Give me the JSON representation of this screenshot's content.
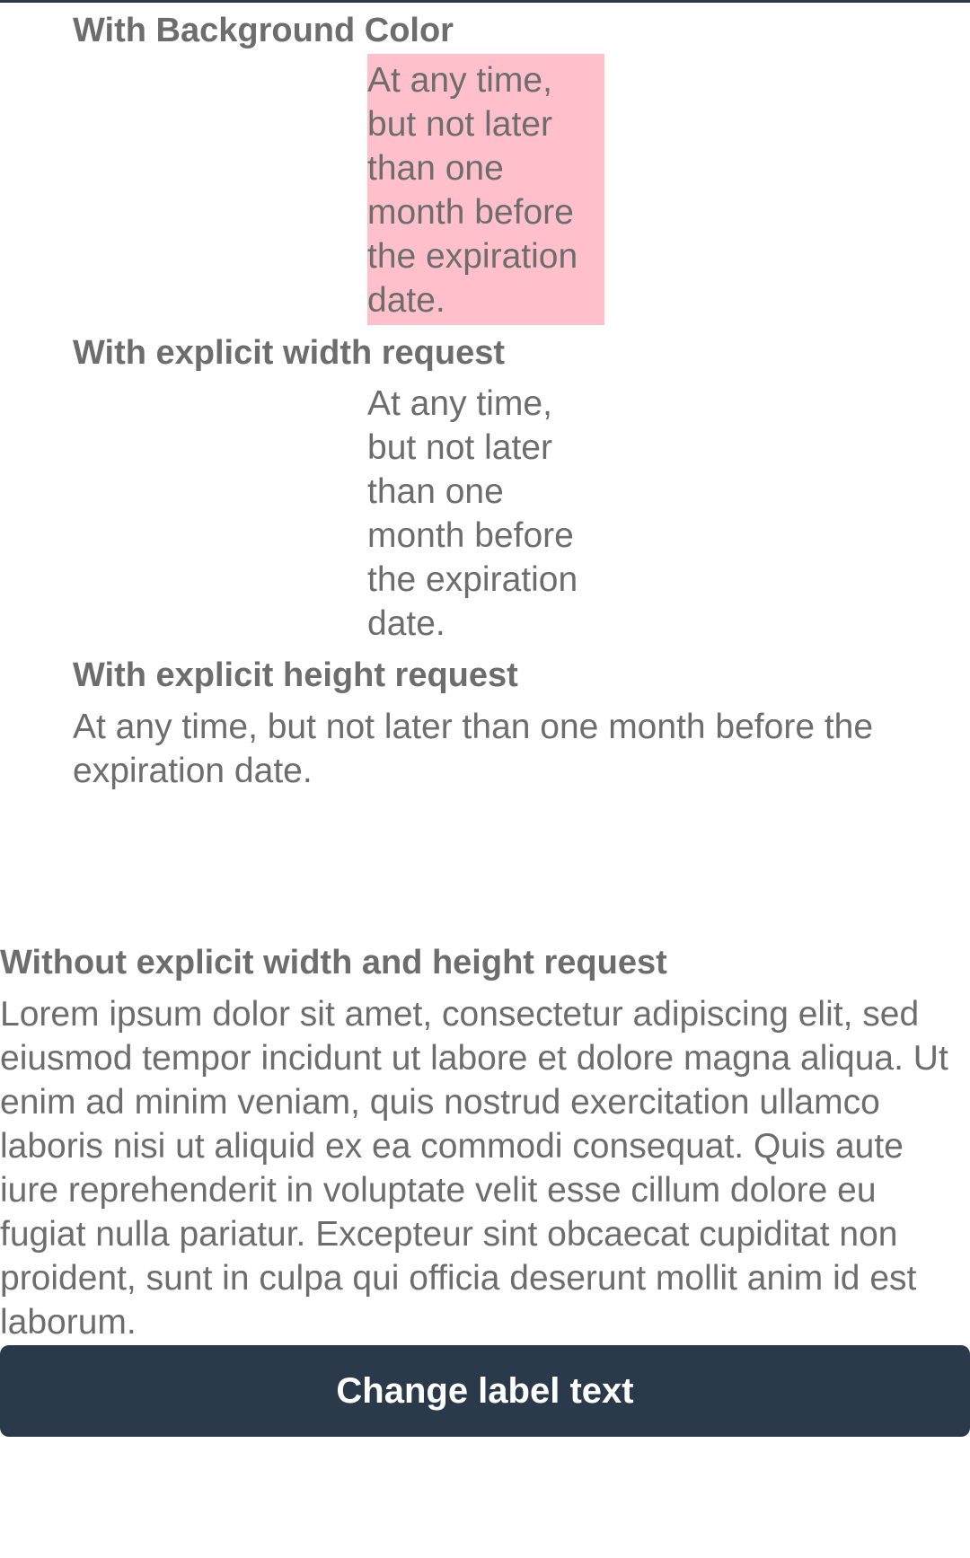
{
  "sections": [
    {
      "heading": "With Background Color",
      "text": "At any time, but not later than one month before the expiration date.",
      "background": "#ffc0cb"
    },
    {
      "heading": "With explicit width request",
      "text": "At any time, but not later than one month before the expiration date."
    },
    {
      "heading": "With explicit height request",
      "text": "At any time, but not later than one month before the expiration date."
    },
    {
      "heading": "Without explicit width and height request",
      "text": "Lorem ipsum dolor sit amet, consectetur adipiscing elit, sed eiusmod tempor incidunt ut labore et dolore magna aliqua. Ut enim ad minim veniam, quis nostrud exercitation ullamco laboris nisi ut aliquid ex ea commodi consequat. Quis aute iure reprehenderit in voluptate velit esse cillum dolore eu fugiat nulla pariatur. Excepteur sint obcaecat cupiditat non proident, sunt in culpa qui officia deserunt mollit anim id est laborum."
    }
  ],
  "button": {
    "label": "Change label text"
  },
  "colors": {
    "text": "#6d6d6d",
    "button_bg": "#2b3a4a",
    "button_text": "#ffffff",
    "highlight_bg": "#ffc0cb"
  }
}
